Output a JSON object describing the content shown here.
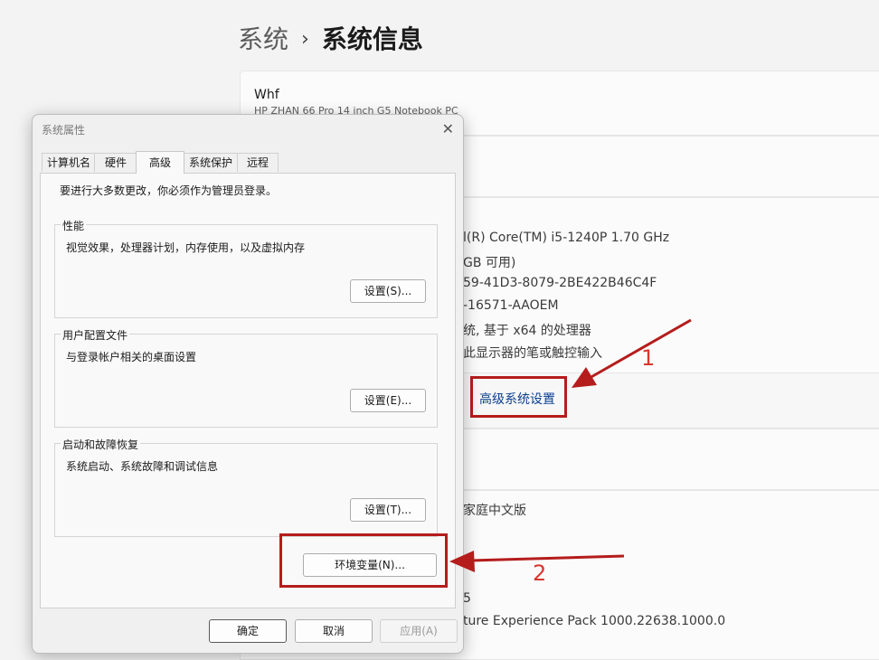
{
  "breadcrumb": {
    "parent": "系统",
    "separator": "›",
    "current": "系统信息"
  },
  "device": {
    "name": "Whf",
    "model": "HP ZHAN 66 Pro 14 inch G5 Notebook PC"
  },
  "specs": [
    "l(R) Core(TM) i5-1240P   1.70 GHz",
    "GB 可用)",
    "59-41D3-8079-2BE422B46C4F",
    "-16571-AAOEM",
    "统, 基于 x64 的处理器",
    "此显示器的笔或触控输入"
  ],
  "advanced_link": "高级系统设置",
  "windows_specs": {
    "edition_partial": "家庭中文版",
    "version_partial": "5",
    "experience_partial": "ture Experience Pack 1000.22638.1000.0"
  },
  "annotations": {
    "one": "1",
    "two": "2",
    "arrow_color": "#b51c1c"
  },
  "dialog": {
    "title": "系统属性",
    "close": "✕",
    "tabs": [
      "计算机名",
      "硬件",
      "高级",
      "系统保护",
      "远程"
    ],
    "active_tab": "高级",
    "intro": "要进行大多数更改，你必须作为管理员登录。",
    "performance": {
      "label": "性能",
      "desc": "视觉效果，处理器计划，内存使用，以及虚拟内存",
      "button": "设置(S)..."
    },
    "user_profiles": {
      "label": "用户配置文件",
      "desc": "与登录帐户相关的桌面设置",
      "button": "设置(E)..."
    },
    "startup": {
      "label": "启动和故障恢复",
      "desc": "系统启动、系统故障和调试信息",
      "button": "设置(T)..."
    },
    "env_button": "环境变量(N)...",
    "ok": "确定",
    "cancel": "取消",
    "apply": "应用(A)"
  }
}
